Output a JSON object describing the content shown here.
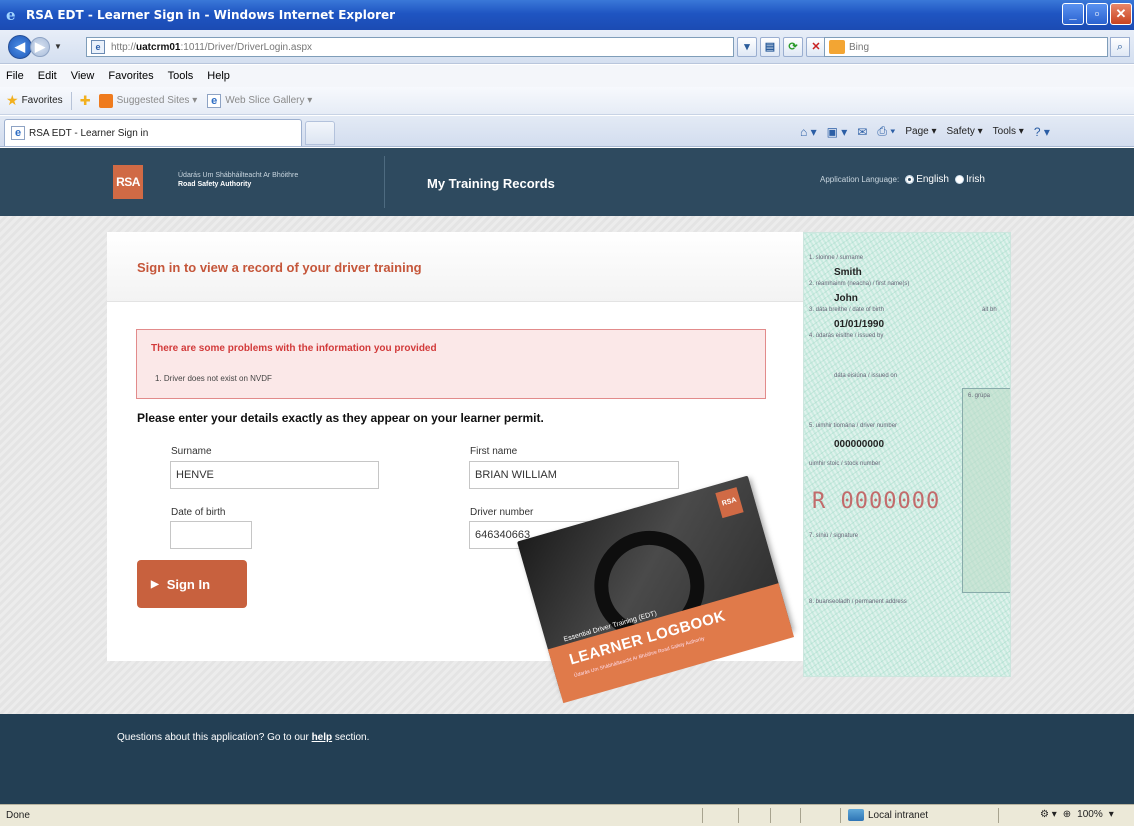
{
  "window": {
    "title": "RSA EDT - Learner Sign in - Windows Internet Explorer",
    "buttons": [
      "_",
      "▫",
      "✕"
    ]
  },
  "address_bar": {
    "url_prefix": "http://",
    "url_host": "uatcrm01",
    "url_rest": ":1011/Driver/DriverLogin.aspx",
    "search_placeholder": "Bing"
  },
  "menu": [
    "File",
    "Edit",
    "View",
    "Favorites",
    "Tools",
    "Help"
  ],
  "favorites_bar": {
    "favorites_label": "Favorites",
    "suggested_sites": "Suggested Sites ▾",
    "web_slice_gallery": "Web Slice Gallery ▾"
  },
  "tab": {
    "label": "RSA EDT - Learner Sign in"
  },
  "command_bar": {
    "page": "Page ▾",
    "safety": "Safety ▾",
    "tools": "Tools ▾"
  },
  "site_header": {
    "logo_text": "RSA",
    "org_irish": "Údarás Um Shábháilteacht Ar Bhóithre",
    "org_english": "Road Safety Authority",
    "app_title": "My Training Records",
    "language_label": "Application Language:",
    "language_options": [
      "English",
      "Irish"
    ],
    "language_selected": "English"
  },
  "signin": {
    "title": "Sign in to view a record of your driver training",
    "error_title": "There are some problems with the information you provided",
    "error_items": [
      "1.   Driver does not exist on NVDF"
    ],
    "instructions": "Please enter your details exactly as they appear on your learner permit.",
    "surname_label": "Surname",
    "surname_value": "HENVE",
    "firstname_label": "First name",
    "firstname_value": "BRIAN WILLIAM",
    "dob_label": "Date of birth",
    "dob_value": "",
    "driver_number_label": "Driver number",
    "driver_number_value": "646340663",
    "signin_button": "Sign In"
  },
  "logbook": {
    "subtitle": "Essential Driver Training (EDT)",
    "title": "LEARNER LOGBOOK",
    "footer": "Údarás Um Shábháilteacht Ar Bhóithre Road Safety Authority",
    "logo": "RSA"
  },
  "permit": {
    "f1_label": "1.   sloinne / surname",
    "f1_value": "Smith",
    "f2_label": "2.   réamhainm (neacha) / first name(s)",
    "f2_value": "John",
    "f3_label": "3.   dáta breithe / date of birth",
    "f3_extra": "áit bh",
    "f3_value": "01/01/1990",
    "f4_label": "4.   údarás eisithe / issued by",
    "f4b_label": "dáta eisiúna / issued on",
    "f6_label": "6.   grúpa",
    "f5_label": "5.   uimhir tiomána / driver number",
    "f5_value": "000000000",
    "stock_label": "uimhir stoic / stock number",
    "big_number": "R  0000000",
    "f7_label": "7.   síniú / signature",
    "f8_label": "8.   buanseoladh / permanent address"
  },
  "footer": {
    "text_before": "Questions about this application? Go to our ",
    "link": "help",
    "text_after": " section."
  },
  "status_bar": {
    "status": "Done",
    "zone": "Local intranet",
    "zoom": "100%"
  },
  "colors": {
    "header_bg": "#2e4a5f",
    "accent": "#c8613e",
    "error_text": "#d23a3a",
    "footer_bg": "#233f54"
  }
}
